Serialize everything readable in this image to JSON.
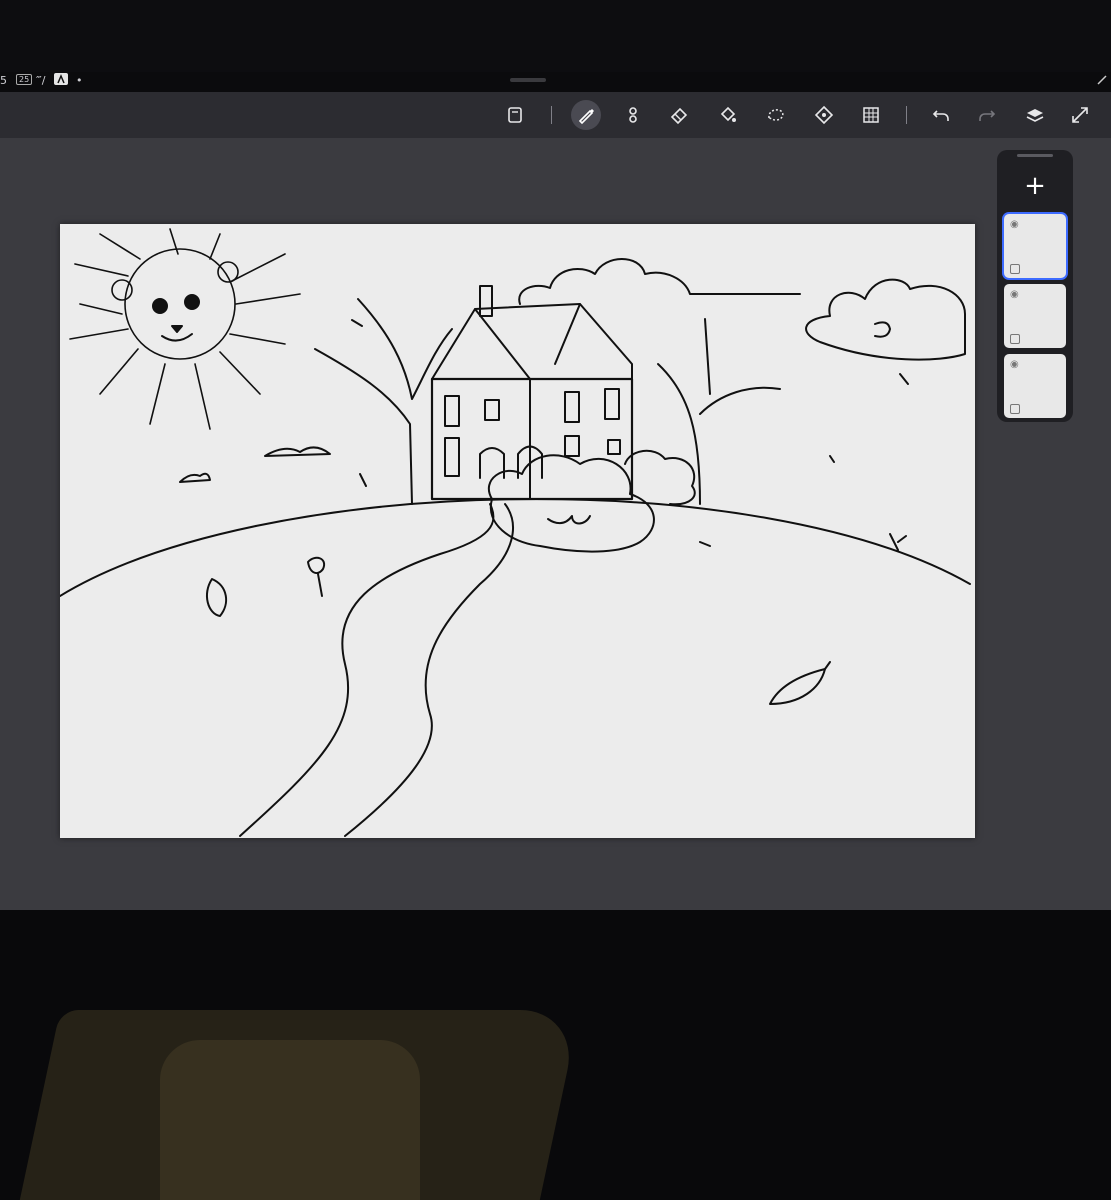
{
  "statusbar": {
    "time_fragment": "5",
    "badge": "25",
    "signal_text": "‴/",
    "app_icon": "procreate-logo",
    "dot": "•"
  },
  "toolbar": {
    "tools": [
      {
        "name": "gallery",
        "icon": "gallery-icon"
      },
      {
        "name": "brush",
        "icon": "brush-icon",
        "active": true
      },
      {
        "name": "smudge",
        "icon": "smudge-icon"
      },
      {
        "name": "eraser",
        "icon": "eraser-icon"
      },
      {
        "name": "fill",
        "icon": "fill-icon"
      },
      {
        "name": "selection",
        "icon": "lasso-icon"
      },
      {
        "name": "transform",
        "icon": "transform-icon"
      },
      {
        "name": "grid",
        "icon": "grid-icon"
      },
      {
        "name": "undo",
        "icon": "undo-icon"
      },
      {
        "name": "redo",
        "icon": "redo-icon"
      },
      {
        "name": "layers",
        "icon": "layers-icon"
      },
      {
        "name": "fullscreen",
        "icon": "expand-icon"
      }
    ]
  },
  "layers_panel": {
    "add_label": "+",
    "layers": [
      {
        "visible": true,
        "locked": false,
        "active": true
      },
      {
        "visible": true,
        "locked": false,
        "active": false
      },
      {
        "visible": true,
        "locked": false,
        "active": false
      }
    ]
  },
  "canvas": {
    "subject": "line drawing",
    "colors": {
      "paper": "#ececec",
      "ink": "#111111"
    }
  },
  "colors": {
    "toolbar": "#2c2c31",
    "workspace": "#3b3b40",
    "layer_active": "#3d6bff"
  }
}
